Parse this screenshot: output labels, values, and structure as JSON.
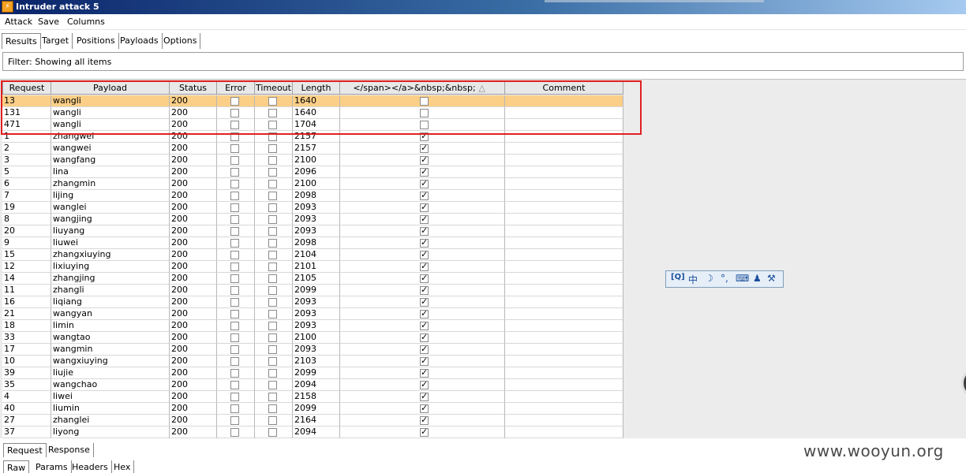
{
  "window": {
    "title": "Intruder attack 5"
  },
  "menu": [
    "Attack",
    "Save",
    "Columns"
  ],
  "tabs": [
    "Results",
    "Target",
    "Positions",
    "Payloads",
    "Options"
  ],
  "filter": {
    "text": "Filter:  Showing all items"
  },
  "table": {
    "columns": [
      "Request",
      "Payload",
      "Status",
      "Error",
      "Timeout",
      "Length",
      "</span></a>&nbsp;&nbsp;",
      "Comment"
    ],
    "sort_indicator": "△",
    "rows": [
      {
        "request": "13",
        "payload": "wangli",
        "status": "200",
        "error": false,
        "timeout": false,
        "length": "1640",
        "match": false,
        "comment": ""
      },
      {
        "request": "131",
        "payload": "wangli",
        "status": "200",
        "error": false,
        "timeout": false,
        "length": "1640",
        "match": false,
        "comment": ""
      },
      {
        "request": "471",
        "payload": "wangli",
        "status": "200",
        "error": false,
        "timeout": false,
        "length": "1704",
        "match": false,
        "comment": ""
      },
      {
        "request": "1",
        "payload": "zhangwei",
        "status": "200",
        "error": false,
        "timeout": false,
        "length": "2157",
        "match": true,
        "comment": ""
      },
      {
        "request": "2",
        "payload": "wangwei",
        "status": "200",
        "error": false,
        "timeout": false,
        "length": "2157",
        "match": true,
        "comment": ""
      },
      {
        "request": "3",
        "payload": "wangfang",
        "status": "200",
        "error": false,
        "timeout": false,
        "length": "2100",
        "match": true,
        "comment": ""
      },
      {
        "request": "5",
        "payload": "lina",
        "status": "200",
        "error": false,
        "timeout": false,
        "length": "2096",
        "match": true,
        "comment": ""
      },
      {
        "request": "6",
        "payload": "zhangmin",
        "status": "200",
        "error": false,
        "timeout": false,
        "length": "2100",
        "match": true,
        "comment": ""
      },
      {
        "request": "7",
        "payload": "lijing",
        "status": "200",
        "error": false,
        "timeout": false,
        "length": "2098",
        "match": true,
        "comment": ""
      },
      {
        "request": "19",
        "payload": "wanglei",
        "status": "200",
        "error": false,
        "timeout": false,
        "length": "2093",
        "match": true,
        "comment": ""
      },
      {
        "request": "8",
        "payload": "wangjing",
        "status": "200",
        "error": false,
        "timeout": false,
        "length": "2093",
        "match": true,
        "comment": ""
      },
      {
        "request": "20",
        "payload": "liuyang",
        "status": "200",
        "error": false,
        "timeout": false,
        "length": "2093",
        "match": true,
        "comment": ""
      },
      {
        "request": "9",
        "payload": "liuwei",
        "status": "200",
        "error": false,
        "timeout": false,
        "length": "2098",
        "match": true,
        "comment": ""
      },
      {
        "request": "15",
        "payload": "zhangxiuying",
        "status": "200",
        "error": false,
        "timeout": false,
        "length": "2104",
        "match": true,
        "comment": ""
      },
      {
        "request": "12",
        "payload": "lixiuying",
        "status": "200",
        "error": false,
        "timeout": false,
        "length": "2101",
        "match": true,
        "comment": ""
      },
      {
        "request": "14",
        "payload": "zhangjing",
        "status": "200",
        "error": false,
        "timeout": false,
        "length": "2105",
        "match": true,
        "comment": ""
      },
      {
        "request": "11",
        "payload": "zhangli",
        "status": "200",
        "error": false,
        "timeout": false,
        "length": "2099",
        "match": true,
        "comment": ""
      },
      {
        "request": "16",
        "payload": "liqiang",
        "status": "200",
        "error": false,
        "timeout": false,
        "length": "2093",
        "match": true,
        "comment": ""
      },
      {
        "request": "21",
        "payload": "wangyan",
        "status": "200",
        "error": false,
        "timeout": false,
        "length": "2093",
        "match": true,
        "comment": ""
      },
      {
        "request": "18",
        "payload": "limin",
        "status": "200",
        "error": false,
        "timeout": false,
        "length": "2093",
        "match": true,
        "comment": ""
      },
      {
        "request": "33",
        "payload": "wangtao",
        "status": "200",
        "error": false,
        "timeout": false,
        "length": "2100",
        "match": true,
        "comment": ""
      },
      {
        "request": "17",
        "payload": "wangmin",
        "status": "200",
        "error": false,
        "timeout": false,
        "length": "2093",
        "match": true,
        "comment": ""
      },
      {
        "request": "10",
        "payload": "wangxiuying",
        "status": "200",
        "error": false,
        "timeout": false,
        "length": "2103",
        "match": true,
        "comment": ""
      },
      {
        "request": "39",
        "payload": "liujie",
        "status": "200",
        "error": false,
        "timeout": false,
        "length": "2099",
        "match": true,
        "comment": ""
      },
      {
        "request": "35",
        "payload": "wangchao",
        "status": "200",
        "error": false,
        "timeout": false,
        "length": "2094",
        "match": true,
        "comment": ""
      },
      {
        "request": "4",
        "payload": "liwei",
        "status": "200",
        "error": false,
        "timeout": false,
        "length": "2158",
        "match": true,
        "comment": ""
      },
      {
        "request": "40",
        "payload": "liumin",
        "status": "200",
        "error": false,
        "timeout": false,
        "length": "2099",
        "match": true,
        "comment": ""
      },
      {
        "request": "27",
        "payload": "zhanglei",
        "status": "200",
        "error": false,
        "timeout": false,
        "length": "2164",
        "match": true,
        "comment": ""
      },
      {
        "request": "37",
        "payload": "liyong",
        "status": "200",
        "error": false,
        "timeout": false,
        "length": "2094",
        "match": true,
        "comment": ""
      }
    ]
  },
  "ime_toolbar": [
    "[Q]",
    "中",
    "☽",
    "°,",
    "⌨",
    "♟",
    "⚒"
  ],
  "bottom_tabs": [
    "Request",
    "Response"
  ],
  "sub_tabs": [
    "Raw",
    "Params",
    "Headers",
    "Hex"
  ],
  "watermark": "www.wooyun.org",
  "colors": {
    "highlight": "#fbcf88",
    "annotation": "#e02020",
    "title_bar": "#0a246a"
  }
}
